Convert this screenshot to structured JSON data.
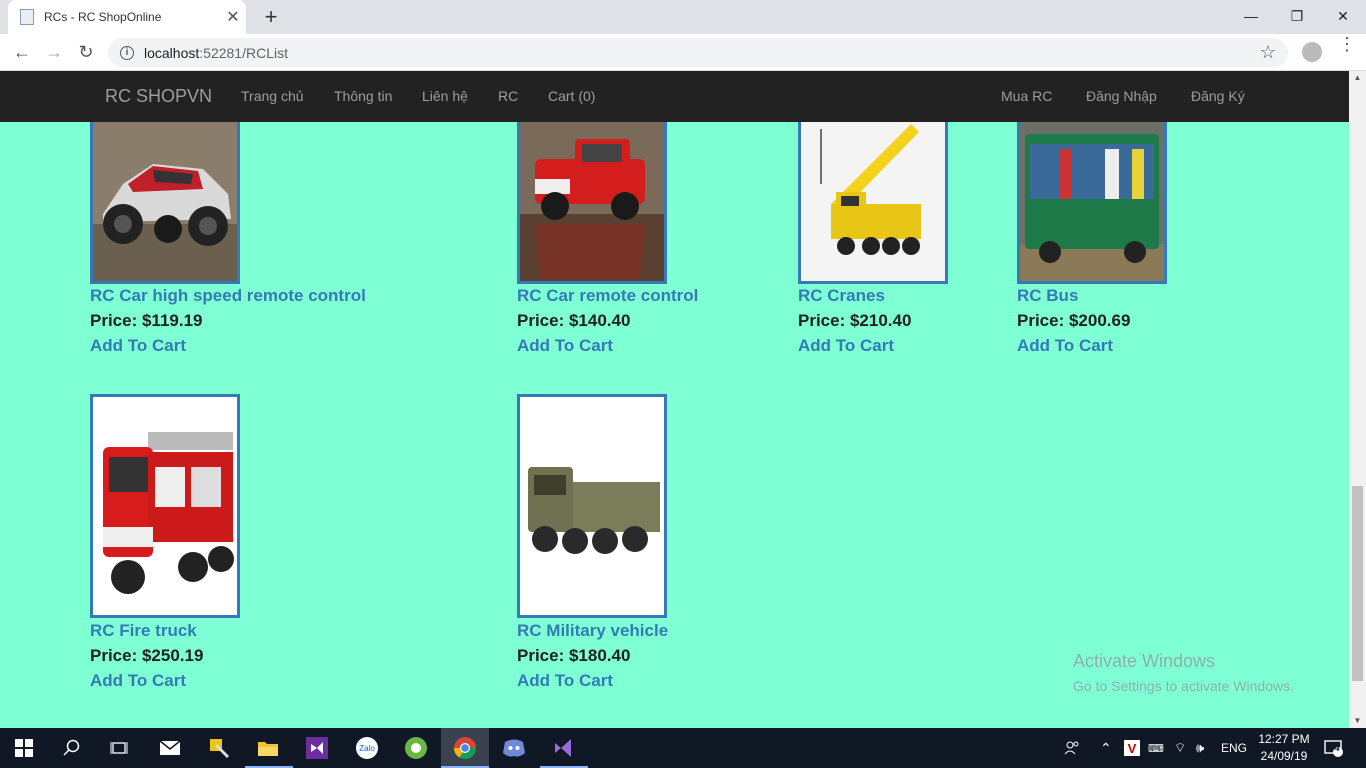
{
  "browser": {
    "tab_title": "RCs - RC ShopOnline",
    "url_host": "localhost",
    "url_path": ":52281/RCList"
  },
  "navbar": {
    "brand": "RC SHOPVN",
    "left_links": [
      "Trang chủ",
      "Thông tin",
      "Liên hệ",
      "RC",
      "Cart (0)"
    ],
    "right_links": [
      "Mua RC",
      "Đăng Nhập",
      "Đăng Ký"
    ]
  },
  "products": [
    {
      "name": "RC Car high speed remote control",
      "price": "Price: $119.19",
      "cart": "Add To Cart"
    },
    {
      "name": "RC Car remote control",
      "price": "Price: $140.40",
      "cart": "Add To Cart"
    },
    {
      "name": "RC Cranes",
      "price": "Price: $210.40",
      "cart": "Add To Cart"
    },
    {
      "name": "RC Bus",
      "price": "Price: $200.69",
      "cart": "Add To Cart"
    },
    {
      "name": "RC Fire truck",
      "price": "Price: $250.19",
      "cart": "Add To Cart"
    },
    {
      "name": "RC Military vehicle",
      "price": "Price: $180.40",
      "cart": "Add To Cart"
    }
  ],
  "watermark": {
    "line1": "Activate Windows",
    "line2": "Go to Settings to activate Windows."
  },
  "taskbar": {
    "language": "ENG",
    "time": "12:27 PM",
    "date": "24/09/19",
    "notification_count": "4",
    "apps": [
      "windows-start-icon",
      "search-icon",
      "task-view-icon",
      "mail-icon",
      "tool-icon",
      "file-explorer-icon",
      "visual-studio-icon",
      "zalo-icon",
      "coccoc-icon",
      "chrome-icon",
      "discord-icon",
      "visual-studio-2-icon"
    ]
  }
}
